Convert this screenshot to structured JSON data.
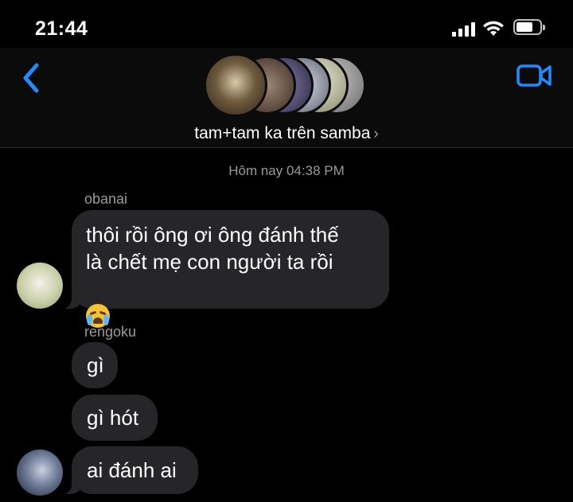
{
  "status_bar": {
    "time": "21:44",
    "icons": [
      "signal-icon",
      "wifi-icon",
      "battery-icon"
    ]
  },
  "header": {
    "back_icon": "chevron-left-icon",
    "video_icon": "video-camera-icon",
    "group_name": "tam+tam ka trên samba",
    "group_chevron": "›",
    "accent_color": "#1e8cff"
  },
  "chat": {
    "timestamp": "Hôm nay 04:38 PM",
    "messages": [
      {
        "sender": "obanai",
        "lines": "thôi rồi ông ơi ông đánh thế\nlà chết mẹ con người ta rồi",
        "emoji": "loudly-crying-face-icon"
      },
      {
        "sender": "rengoku",
        "text": "gì"
      },
      {
        "text": "gì hót"
      },
      {
        "text": "ai đánh ai"
      }
    ],
    "bubble_color": "#262628"
  }
}
